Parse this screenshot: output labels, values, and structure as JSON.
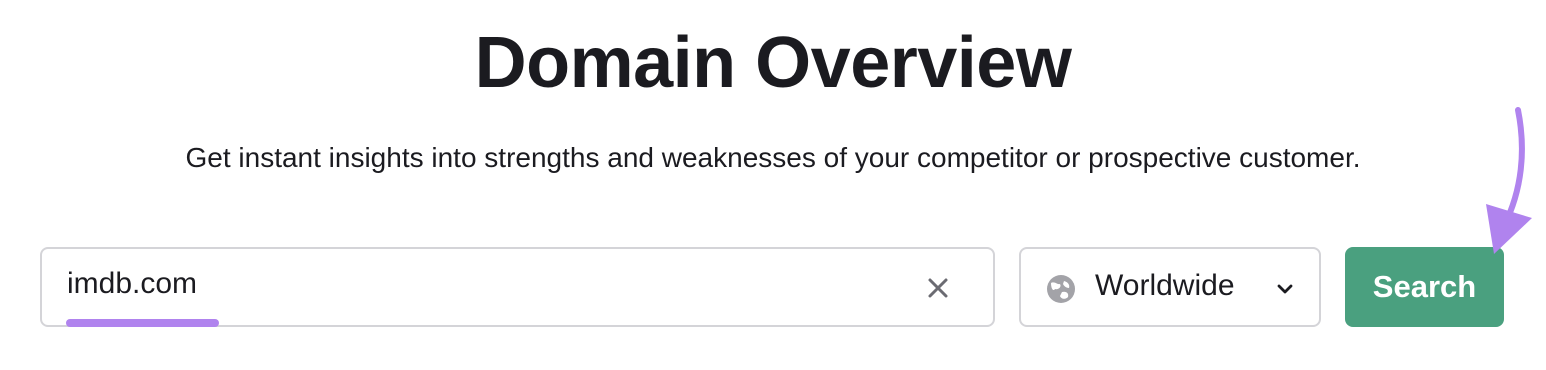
{
  "header": {
    "title": "Domain Overview",
    "subtitle": "Get instant insights into strengths and weaknesses of your competitor or prospective customer."
  },
  "search_form": {
    "domain_value": "imdb.com",
    "region_value": "Worldwide",
    "search_label": "Search"
  },
  "icons": {
    "clear": "close-icon",
    "globe": "globe-icon",
    "dropdown": "chevron-down-icon"
  },
  "colors": {
    "accent": "#4aa07f",
    "annotation": "#b083ee",
    "text": "#1b1b20",
    "border": "#d4d4d8"
  }
}
